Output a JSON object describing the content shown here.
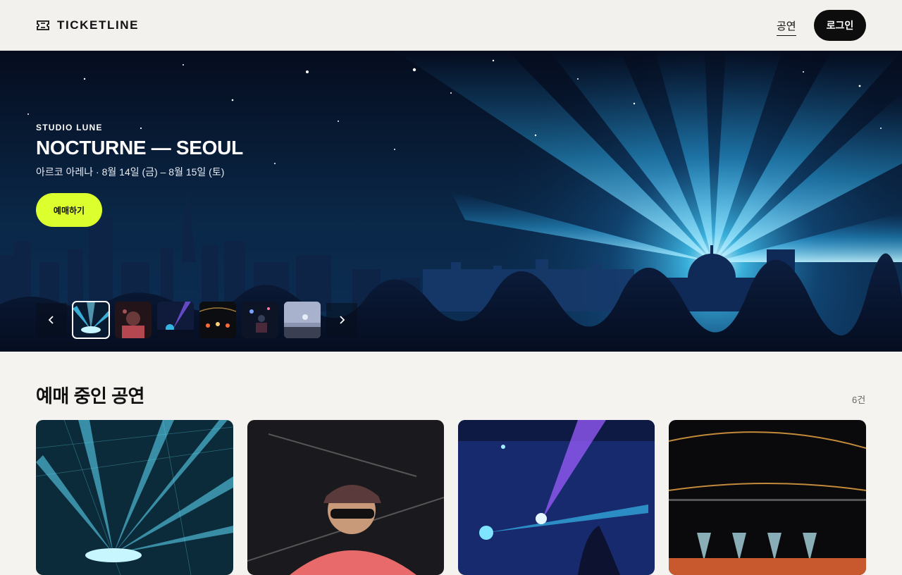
{
  "header": {
    "logo_text": "TICKETLINE",
    "nav_link": "공연",
    "login_label": "로그인"
  },
  "hero": {
    "eyebrow": "STUDIO LUNE",
    "title": "NOCTURNE — SEOUL",
    "subtitle": "아르코 아레나 · 8월 14일 (금) – 8월 15일 (토)",
    "book_label": "예매하기",
    "thumbnails": 6,
    "active_thumbnail": 1
  },
  "section": {
    "title": "예매 중인 공연",
    "count": "6건"
  },
  "colors": {
    "accent": "#dcff2e",
    "dark": "#0d0d0d",
    "hero_sky": "#06122a",
    "beam": "#36c9ff"
  },
  "icons": {
    "logo": "ticket-icon",
    "prev": "chevron-left-icon",
    "next": "chevron-right-icon"
  }
}
